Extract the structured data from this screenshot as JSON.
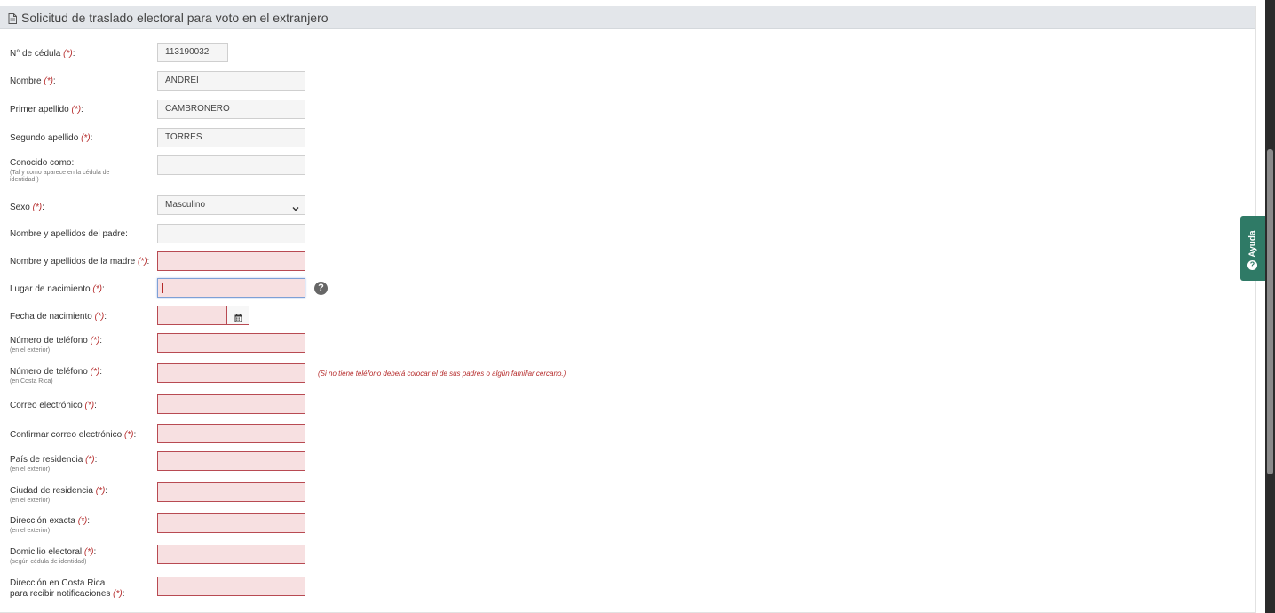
{
  "header": {
    "title": "Solicitud de traslado electoral para voto en el extranjero"
  },
  "req_marker": "(*)",
  "fields": {
    "cedula": {
      "label": "N° de cédula",
      "value": "113190032"
    },
    "nombre": {
      "label": "Nombre",
      "value": "ANDREI"
    },
    "primer_apellido": {
      "label": "Primer apellido",
      "value": "CAMBRONERO"
    },
    "segundo_apellido": {
      "label": "Segundo apellido",
      "value": "TORRES"
    },
    "conocido": {
      "label": "Conocido como:",
      "sub": "(Tal y como aparece en la cédula de identidad.)",
      "value": ""
    },
    "sexo": {
      "label": "Sexo",
      "value": "Masculino"
    },
    "padre": {
      "label": "Nombre y apellidos del padre:",
      "value": ""
    },
    "madre": {
      "label": "Nombre y apellidos de la madre",
      "value": ""
    },
    "lugar_nac": {
      "label": "Lugar de nacimiento",
      "value": ""
    },
    "fecha_nac": {
      "label": "Fecha de nacimiento",
      "value": ""
    },
    "tel_ext": {
      "label": "Número de teléfono",
      "sub": "(en el exterior)",
      "value": ""
    },
    "tel_cr": {
      "label": "Número de teléfono",
      "sub": "(en Costa Rica)",
      "value": "",
      "hint": "(Si no tiene teléfono deberá colocar el de sus padres o algún familiar cercano.)"
    },
    "correo": {
      "label": "Correo electrónico",
      "value": ""
    },
    "correo_conf": {
      "label": "Confirmar correo electrónico",
      "value": ""
    },
    "pais": {
      "label": "País de residencia",
      "sub": "(en el exterior)",
      "value": ""
    },
    "ciudad": {
      "label": "Ciudad de residencia",
      "sub": "(en el exterior)",
      "value": ""
    },
    "direccion": {
      "label": "Dirección exacta",
      "sub": "(en el exterior)",
      "value": ""
    },
    "domicilio": {
      "label": "Domicilio electoral",
      "sub": "(según cédula de identidad)",
      "value": ""
    },
    "dir_cr_line1": "Dirección en Costa Rica",
    "dir_cr_line2": "para recibir notificaciones",
    "dir_cr_value": ""
  },
  "help_tab": {
    "label": "Ayuda",
    "icon": "question-circle-icon"
  },
  "help_icon": "?",
  "colors": {
    "error_bg": "#f7e0e1",
    "error_border": "#b84a52",
    "required": "#b52a2a",
    "help_tab": "#2f7a66"
  }
}
